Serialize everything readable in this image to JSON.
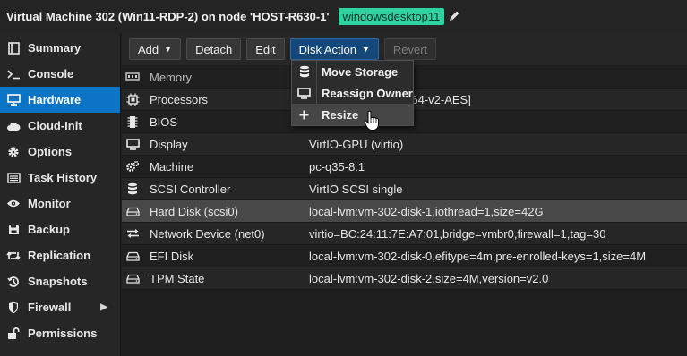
{
  "header": {
    "title": "Virtual Machine 302 (Win11-RDP-2) on node 'HOST-R630-1'",
    "tag": "windowsdesktop11",
    "edit_icon": "pencil-icon"
  },
  "sidebar": {
    "items": [
      {
        "label": "Summary",
        "icon": "book-icon"
      },
      {
        "label": "Console",
        "icon": "terminal-icon"
      },
      {
        "label": "Hardware",
        "icon": "monitor-icon",
        "active": true
      },
      {
        "label": "Cloud-Init",
        "icon": "cloud-icon"
      },
      {
        "label": "Options",
        "icon": "gear-icon"
      },
      {
        "label": "Task History",
        "icon": "list-icon"
      },
      {
        "label": "Monitor",
        "icon": "eye-icon"
      },
      {
        "label": "Backup",
        "icon": "floppy-icon"
      },
      {
        "label": "Replication",
        "icon": "retweet-icon"
      },
      {
        "label": "Snapshots",
        "icon": "history-icon"
      },
      {
        "label": "Firewall",
        "icon": "shield-icon"
      },
      {
        "label": "Permissions",
        "icon": "unlock-icon"
      }
    ]
  },
  "toolbar": {
    "add_label": "Add",
    "detach_label": "Detach",
    "edit_label": "Edit",
    "disk_action_label": "Disk Action",
    "revert_label": "Revert"
  },
  "hardware": {
    "rows": [
      {
        "name": "Memory",
        "value": "",
        "icon": "memory-icon"
      },
      {
        "name": "Processors",
        "value": "s) [x86-64-v2-AES]",
        "icon": "cpu-icon"
      },
      {
        "name": "BIOS",
        "value": "",
        "icon": "microchip-icon"
      },
      {
        "name": "Display",
        "value": "VirtIO-GPU (virtio)",
        "icon": "desktop-icon"
      },
      {
        "name": "Machine",
        "value": "pc-q35-8.1",
        "icon": "cogs-icon"
      },
      {
        "name": "SCSI Controller",
        "value": "VirtIO SCSI single",
        "icon": "database-icon"
      },
      {
        "name": "Hard Disk (scsi0)",
        "value": "local-lvm:vm-302-disk-1,iothread=1,size=42G",
        "icon": "hdd-icon",
        "selected": true
      },
      {
        "name": "Network Device (net0)",
        "value": "virtio=BC:24:11:7E:A7:01,bridge=vmbr0,firewall=1,tag=30",
        "icon": "exchange-icon"
      },
      {
        "name": "EFI Disk",
        "value": "local-lvm:vm-302-disk-0,efitype=4m,pre-enrolled-keys=1,size=4M",
        "icon": "hdd-icon"
      },
      {
        "name": "TPM State",
        "value": "local-lvm:vm-302-disk-2,size=4M,version=v2.0",
        "icon": "hdd-icon"
      }
    ]
  },
  "disk_action_menu": {
    "items": [
      {
        "label": "Move Storage",
        "icon": "database-icon"
      },
      {
        "label": "Reassign Owner",
        "icon": "desktop-icon"
      },
      {
        "label": "Resize",
        "icon": "plus-icon",
        "hover": true
      }
    ]
  },
  "colors": {
    "accent": "#0b74c4",
    "tag_bg": "#2ed3a0",
    "background": "#1e1e1e"
  }
}
